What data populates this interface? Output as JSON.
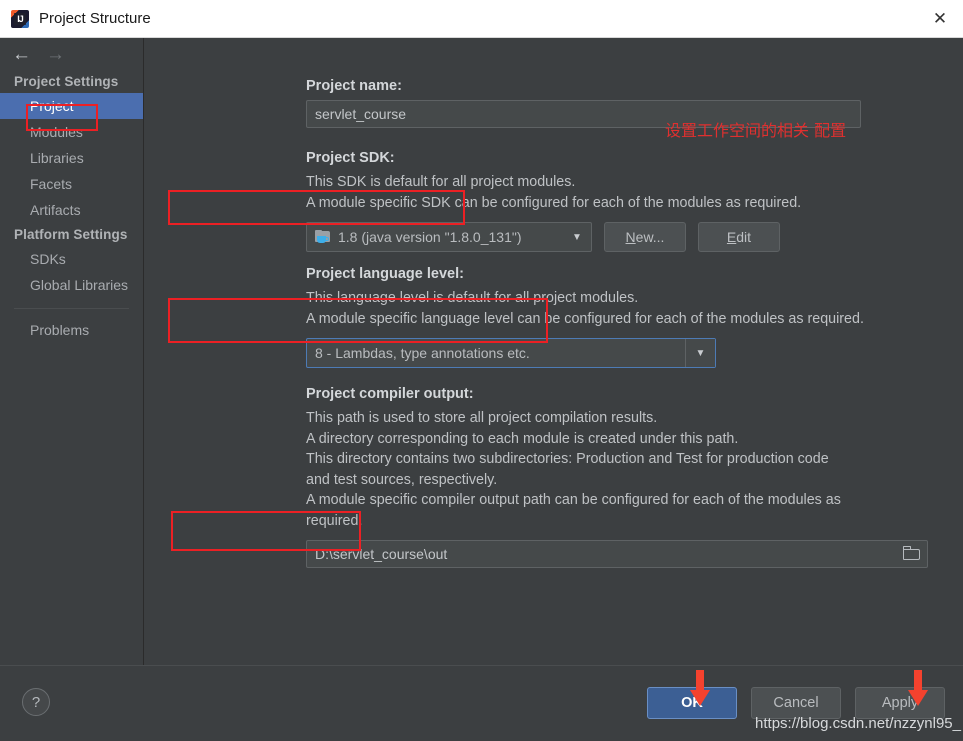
{
  "window": {
    "title": "Project Structure",
    "app_icon": "intellij-idea-icon",
    "close_label": "✕"
  },
  "nav": {
    "back_icon": "←",
    "forward_icon": "→"
  },
  "sidebar": {
    "groups": [
      {
        "header": "Project Settings",
        "items": [
          {
            "label": "Project",
            "selected": true
          },
          {
            "label": "Modules",
            "selected": false
          },
          {
            "label": "Libraries",
            "selected": false
          },
          {
            "label": "Facets",
            "selected": false
          },
          {
            "label": "Artifacts",
            "selected": false
          }
        ]
      },
      {
        "header": "Platform Settings",
        "items": [
          {
            "label": "SDKs",
            "selected": false
          },
          {
            "label": "Global Libraries",
            "selected": false
          }
        ]
      }
    ],
    "problems_label": "Problems"
  },
  "main": {
    "project_name": {
      "label": "Project name:",
      "value": "servlet_course"
    },
    "sdk": {
      "label": "Project SDK:",
      "desc_line1": "This SDK is default for all project modules.",
      "desc_line2": "A module specific SDK can be configured for each of the modules as required.",
      "selected": "1.8 (java version \"1.8.0_131\")",
      "icon": "java-sdk-folder-icon",
      "caret": "▼",
      "new_button": "New...",
      "new_button_mnemonic": "N",
      "new_button_rest": "ew...",
      "edit_button": "Edit",
      "edit_button_mnemonic": "E",
      "edit_button_rest": "dit"
    },
    "language_level": {
      "label": "Project language level:",
      "desc_line1": "This language level is default for all project modules.",
      "desc_line2": "A module specific language level can be configured for each of the modules as required.",
      "selected": "8 - Lambdas, type annotations etc.",
      "caret": "▼"
    },
    "compiler_output": {
      "label": "Project compiler output:",
      "desc_line1": "This path is used to store all project compilation results.",
      "desc_line2": "A directory corresponding to each module is created under this path.",
      "desc_line3": "This directory contains two subdirectories: Production and Test for production code",
      "desc_line4": "and test sources, respectively.",
      "desc_line5": "A module specific compiler output path can be configured for each of the modules as",
      "desc_line6": "required.",
      "value": "D:\\servlet_course\\out",
      "browse_icon": "folder-browse-icon"
    }
  },
  "annotations": {
    "chinese_note": "设置工作空间的相关 配置",
    "highlight_color": "#ec2024",
    "arrow_color": "#f4422e"
  },
  "footer": {
    "help_label": "?",
    "ok_label": "OK",
    "cancel_label": "Cancel",
    "apply_label": "Apply"
  },
  "watermark": {
    "text": "https://blog.csdn.net/nzzynl95_"
  }
}
